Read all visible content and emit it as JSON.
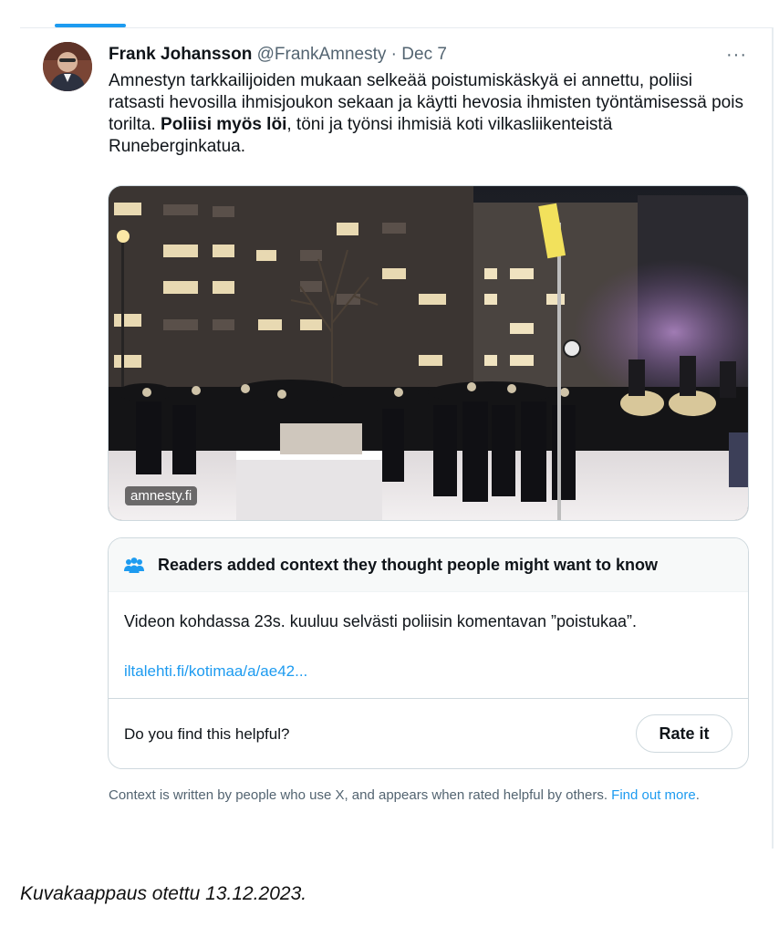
{
  "tweet": {
    "author_name": "Frank Johansson",
    "author_handle": "@FrankAmnesty",
    "separator": "·",
    "date": "Dec 7",
    "more_label": "···",
    "text_part1": "Amnestyn tarkkailijoiden mukaan selkeää poistumiskäskyä ei annettu, poliisi ratsasti hevosilla ihmisjoukon sekaan ja käytti hevosia ihmisten työntämisessä pois torilta. ",
    "text_bold": "Poliisi myös löi",
    "text_part2": ", töni ja työnsi ihmisiä koti vilkasliikenteistä Runeberginkatua.",
    "media_source": "amnesty.fi"
  },
  "community_note": {
    "title": "Readers added context they thought people might want to know",
    "body": "Videon kohdassa 23s. kuuluu selvästi poliisin komentavan ”poistukaa”.",
    "link_text": "iltalehti.fi/kotimaa/a/ae42...",
    "helpful_question": "Do you find this helpful?",
    "rate_button": "Rate it",
    "footer_text": "Context is written by people who use X, and appears when rated helpful by others. ",
    "footer_link": "Find out more",
    "footer_end": "."
  },
  "caption": "Kuvakaappaus otettu 13.12.2023.",
  "colors": {
    "accent": "#1d9bf0",
    "secondary_text": "#536471",
    "border": "#cfd9de"
  },
  "icons": {
    "note_icon": "people-group-icon",
    "more_icon": "more-options-icon"
  }
}
